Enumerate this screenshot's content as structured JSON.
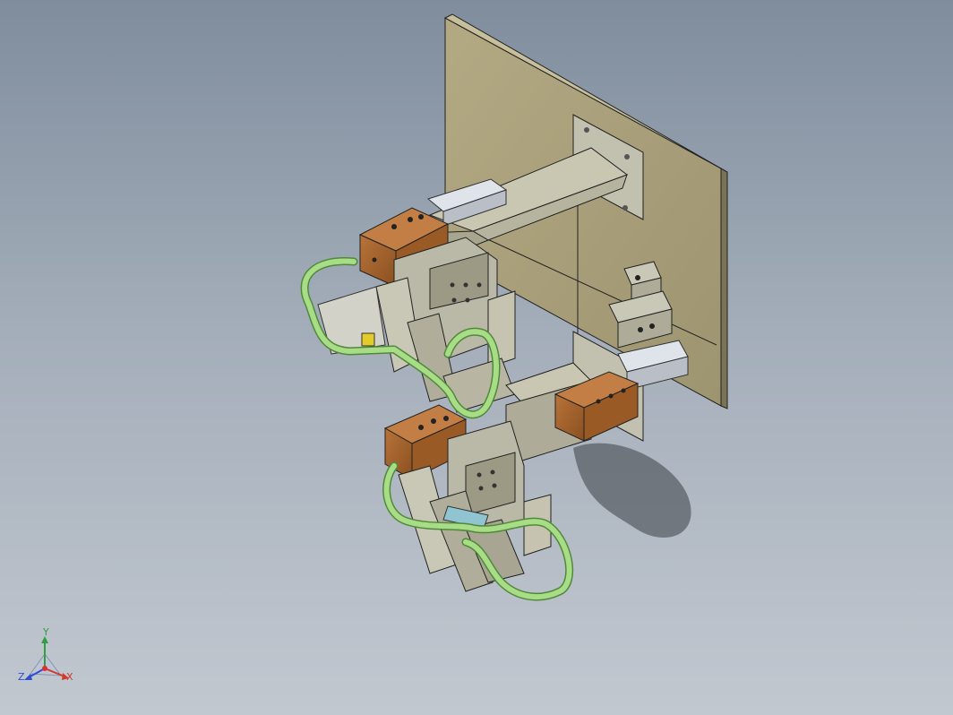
{
  "viewport": {
    "background_top": "#7f8d9d",
    "background_bottom": "#c2c8d0"
  },
  "model": {
    "colors": {
      "backplate": "#aaa07a",
      "steel": "#b9b7a8",
      "steel_dark": "#86846f",
      "copper": "#a8642c",
      "copper_dark": "#7a4518",
      "rail": "#d9dde3",
      "wire": "#a8dc86",
      "wire_edge": "#4f8a3a"
    }
  },
  "triad": {
    "y_label": "Y",
    "x_label": "X",
    "z_label": "Z",
    "y_color": "#2ea043",
    "x_color": "#d03a2c",
    "z_color": "#2c4fd0"
  }
}
